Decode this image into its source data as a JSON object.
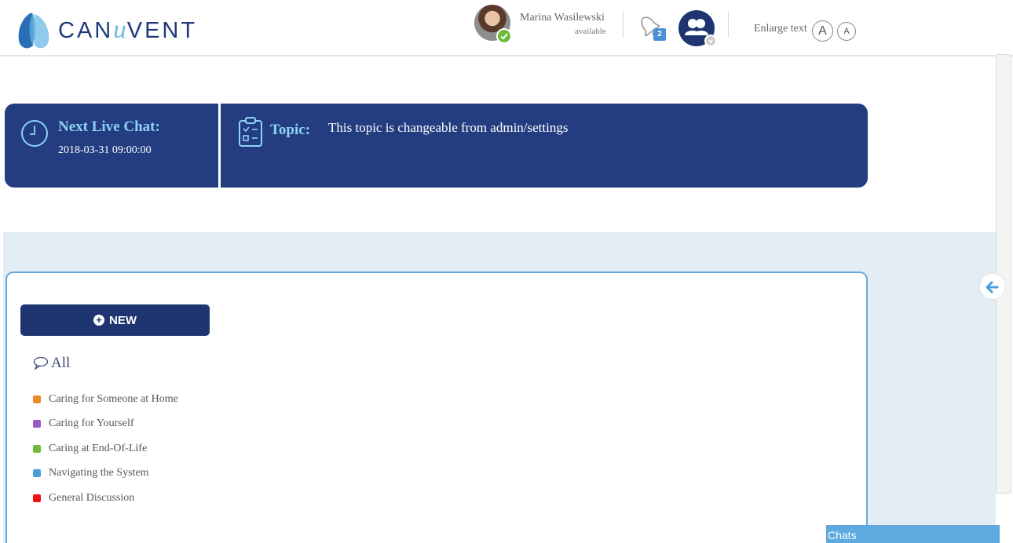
{
  "header": {
    "logo": {
      "prefix": "CAN",
      "u": "u",
      "suffix": "VENT"
    },
    "user": {
      "name": "Marina Wasilewski",
      "status": "available"
    },
    "notifications": {
      "count": "2"
    },
    "enlarge_text": {
      "label": "Enlarge text",
      "large_glyph": "A",
      "small_glyph": "A"
    }
  },
  "banner": {
    "next_live_chat": {
      "label": "Next Live Chat:",
      "value": "2018-03-31 09:00:00"
    },
    "topic": {
      "label": "Topic:",
      "value": "This topic is changeable from admin/settings"
    }
  },
  "forum": {
    "new_button": {
      "icon": "plus-circle-icon",
      "label": "NEW"
    },
    "all_label": "All",
    "categories": [
      {
        "label": "Caring for Someone at Home",
        "color": "#e8892b"
      },
      {
        "label": "Caring for Yourself",
        "color": "#9b59c6"
      },
      {
        "label": "Caring at End-Of-Life",
        "color": "#6dbb3c"
      },
      {
        "label": "Navigating the System",
        "color": "#4a9fd9"
      },
      {
        "label": "General Discussion",
        "color": "#f01010"
      }
    ]
  },
  "chats_tab": {
    "label": "Chats"
  },
  "colors": {
    "brand_navy": "#233d80",
    "accent_light_blue": "#8ed3f5",
    "panel_bg": "#e2eef3"
  }
}
